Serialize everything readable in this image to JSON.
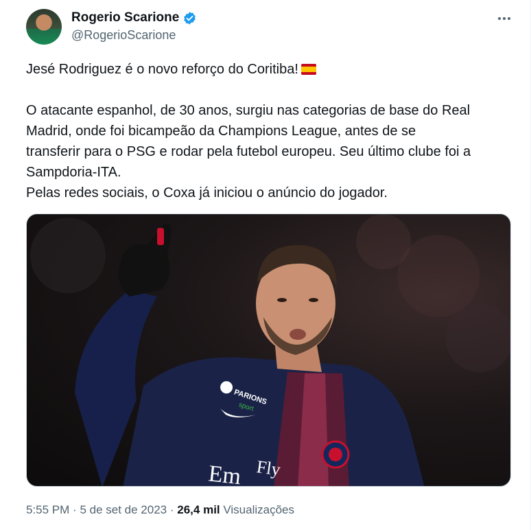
{
  "post": {
    "author_name": "Rogerio Scarione",
    "author_handle": "@RogerioScarione",
    "verified": true,
    "text_line1": "Jesé Rodriguez é o novo reforço do Coritiba!",
    "flag_icon": "spain-flag-icon",
    "paragraph_line1": "O atacante espanhol, de 30 anos, surgiu nas categorias de base do Real",
    "paragraph_line2": "Madrid, onde foi bicampeão da Champions League, antes de se",
    "paragraph_line3": "transferir para o PSG e rodar pela futebol europeu. Seu último clube foi a",
    "paragraph_line4": "Sampdoria-ITA.",
    "paragraph_line5": "Pelas redes sociais, o Coxa já iniciou o anúncio do jogador.",
    "time": "5:55 PM",
    "separator": "·",
    "date": "5 de set de 2023",
    "views_count": "26,4 mil",
    "views_label": "Visualizações"
  },
  "colors": {
    "verified": "#1d9bf0",
    "secondary_text": "#536471",
    "jersey": "#1a2247"
  }
}
